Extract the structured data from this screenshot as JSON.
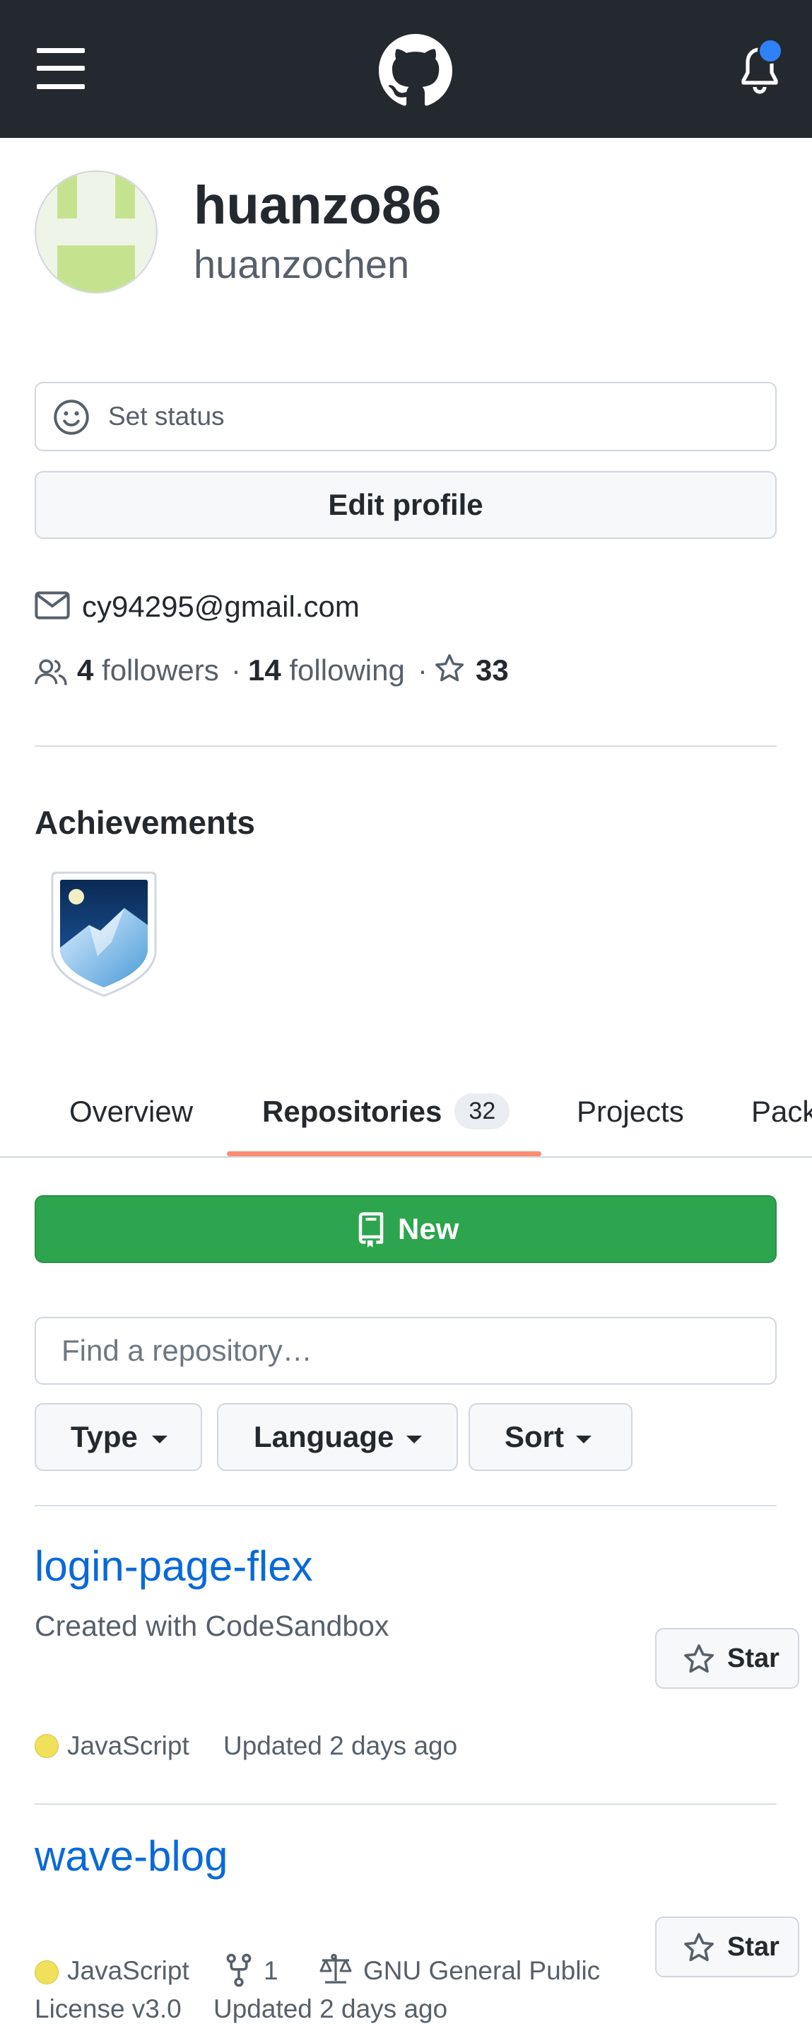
{
  "header": {
    "menu_icon": "hamburger-icon",
    "logo_icon": "github-octocat-icon",
    "notification_icon": "bell-icon",
    "notification_dot_color": "#2f81f7"
  },
  "profile": {
    "name": "huanzo86",
    "login": "huanzochen",
    "avatar_color": "#c5e38f",
    "set_status_label": "Set status",
    "edit_profile_label": "Edit profile",
    "email": "cy94295@gmail.com",
    "followers_count": "4",
    "followers_label": "followers",
    "separator": "·",
    "following_count": "14",
    "following_label": "following",
    "stars_count": "33"
  },
  "achievements": {
    "title": "Achievements",
    "badge_icon": "arctic-code-vault-badge-icon"
  },
  "tabs": {
    "overview": "Overview",
    "repositories": "Repositories",
    "repositories_count": "32",
    "projects": "Projects",
    "packages": "Packages"
  },
  "toolbar": {
    "new_label": "New",
    "search_placeholder": "Find a repository…",
    "type_label": "Type",
    "language_label": "Language",
    "sort_label": "Sort"
  },
  "repos": [
    {
      "name": "login-page-flex",
      "description": "Created with CodeSandbox",
      "language": "JavaScript",
      "language_color": "#f1e05a",
      "updated": "Updated 2 days ago",
      "star_label": "Star"
    },
    {
      "name": "wave-blog",
      "language": "JavaScript",
      "language_color": "#f1e05a",
      "forks": "1",
      "license_line1": "GNU General Public",
      "license_line2": "License v3.0",
      "updated": "Updated 2 days ago",
      "star_label": "Star"
    }
  ]
}
